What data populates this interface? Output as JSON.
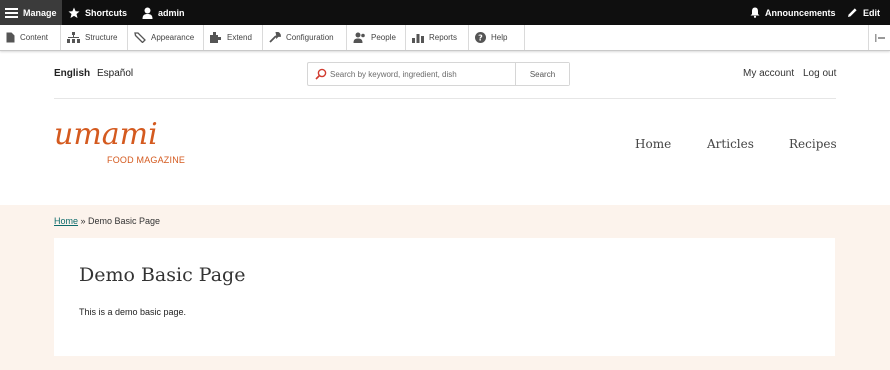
{
  "toolbar": {
    "manage": "Manage",
    "shortcuts": "Shortcuts",
    "user": "admin",
    "announcements": "Announcements",
    "edit": "Edit"
  },
  "tray": {
    "items": [
      {
        "label": "Content",
        "icon": "content-icon"
      },
      {
        "label": "Structure",
        "icon": "structure-icon"
      },
      {
        "label": "Appearance",
        "icon": "appearance-icon"
      },
      {
        "label": "Extend",
        "icon": "extend-icon"
      },
      {
        "label": "Configuration",
        "icon": "configuration-icon"
      },
      {
        "label": "People",
        "icon": "people-icon"
      },
      {
        "label": "Reports",
        "icon": "reports-icon"
      },
      {
        "label": "Help",
        "icon": "help-icon"
      }
    ]
  },
  "header": {
    "lang_en": "English",
    "lang_es": "Español",
    "search_placeholder": "Search by keyword, ingredient, dish",
    "search_button": "Search",
    "my_account": "My account",
    "log_out": "Log out"
  },
  "logo": {
    "word": "umami",
    "sub": "FOOD MAGAZINE"
  },
  "nav": {
    "home": "Home",
    "articles": "Articles",
    "recipes": "Recipes"
  },
  "breadcrumb": {
    "home": "Home",
    "sep": " » ",
    "current": "Demo Basic Page"
  },
  "page": {
    "title": "Demo Basic Page",
    "body": "This is a demo basic page."
  },
  "colors": {
    "brand": "#d45a1f",
    "band": "#fcf3ec",
    "toolbar": "#0f0f0f",
    "link": "#0d6b6b"
  }
}
